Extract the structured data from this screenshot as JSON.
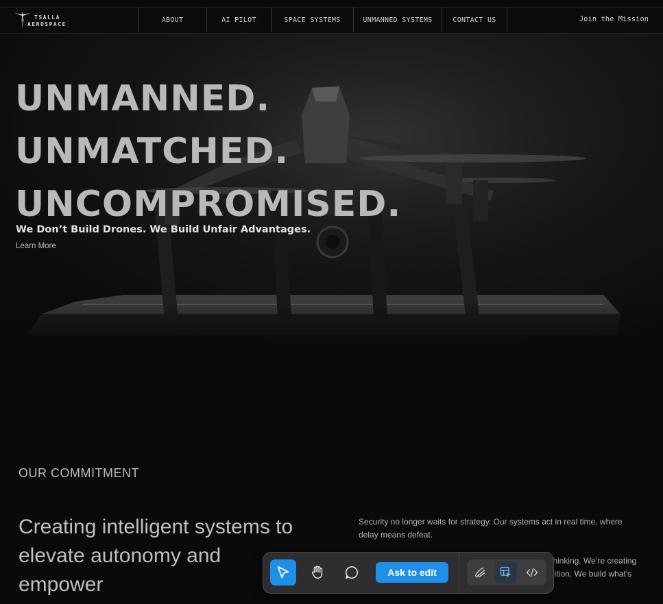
{
  "nav": {
    "brand_line1": "TSALLA",
    "brand_line2": "AEROSPACE",
    "items": [
      {
        "label": "ABOUT"
      },
      {
        "label": "AI PILOT"
      },
      {
        "label": "SPACE SYSTEMS"
      },
      {
        "label": "UNMANNED SYSTEMS"
      },
      {
        "label": "CONTACT US"
      }
    ],
    "cta": "Join the Mission"
  },
  "hero": {
    "line1": "UNMANNED.",
    "line2": "UNMATCHED.",
    "line3": "UNCOMPROMISED.",
    "subtitle": "We Don’t Build Drones. We Build Unfair Advantages.",
    "link": "Learn More"
  },
  "commitment": {
    "eyebrow": "OUR COMMITMENT",
    "heading": "Creating intelligent systems to elevate autonomy and empower",
    "para1": "Security no longer waits for strategy. Our systems act in real time, where delay means defeat.",
    "para2": "thinking. We’re creating autonomous, adaptive, t keep up. We don’t follow tradition. We build what’s necessary."
  },
  "toolbar": {
    "ask_label": "Ask to edit",
    "icons": [
      "pointer-icon",
      "hand-icon",
      "comment-icon",
      "draw-icon",
      "edit-select-icon",
      "code-icon"
    ],
    "accent": "#1f8fe8"
  }
}
